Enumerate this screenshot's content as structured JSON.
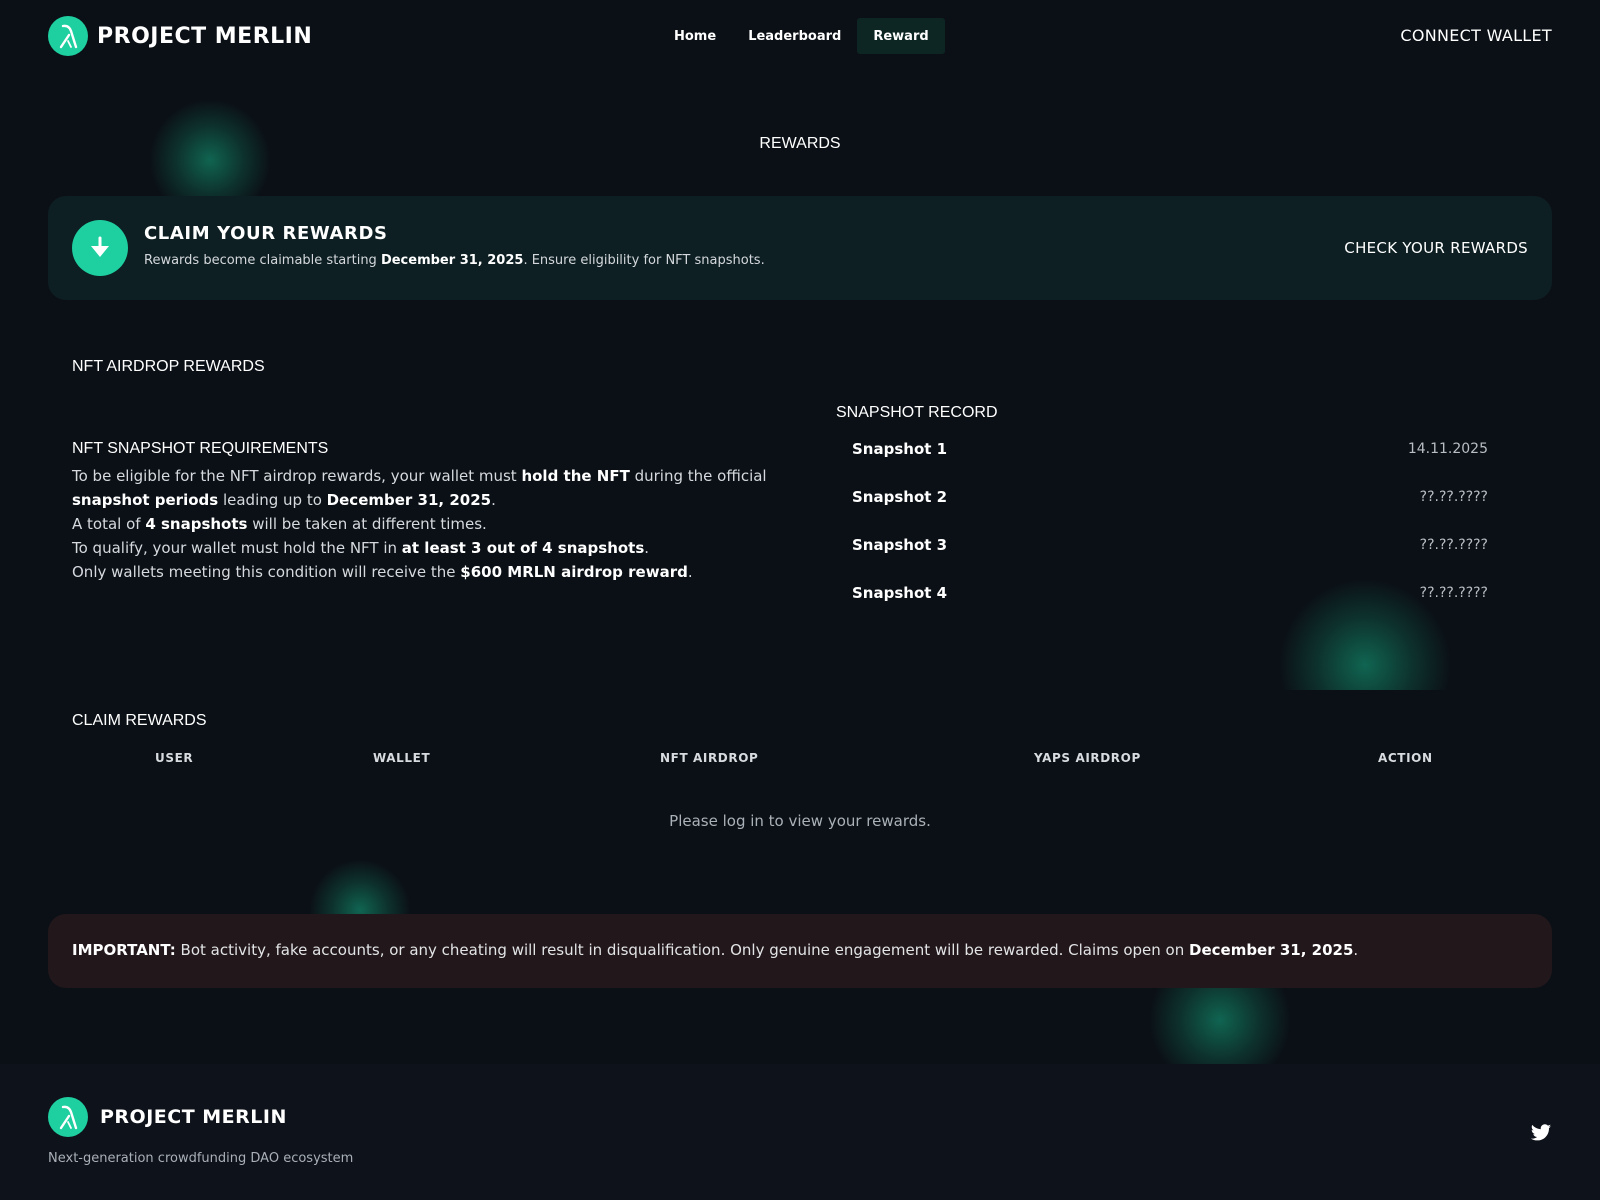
{
  "brand": {
    "name": "PROJECT MERLIN"
  },
  "nav": {
    "items": [
      {
        "label": "Home"
      },
      {
        "label": "Leaderboard"
      },
      {
        "label": "Reward"
      }
    ],
    "connect_label": "CONNECT WALLET"
  },
  "page": {
    "title": "REWARDS"
  },
  "claim_banner": {
    "title": "CLAIM YOUR REWARDS",
    "sub_prefix": "Rewards become claimable starting ",
    "sub_date": "December 31, 2025",
    "sub_suffix": ". Ensure eligibility for NFT snapshots.",
    "action_label": "CHECK YOUR REWARDS"
  },
  "nft": {
    "section_title": "NFT AIRDROP REWARDS",
    "requirements_title": "NFT SNAPSHOT REQUIREMENTS",
    "line1_a": "To be eligible for the NFT airdrop rewards, your wallet must ",
    "line1_b": "hold the NFT",
    "line1_c": " during the official ",
    "line2_a": "snapshot periods",
    "line2_b": " leading up to ",
    "line2_c": "December 31, 2025",
    "line2_d": ".",
    "line3_a": "A total of ",
    "line3_b": "4 snapshots",
    "line3_c": " will be taken at different times.",
    "line4_a": "To qualify, your wallet must hold the NFT in ",
    "line4_b": "at least 3 out of 4 snapshots",
    "line4_c": ".",
    "line5_a": "Only wallets meeting this condition will receive the ",
    "line5_b": "$600 MRLN airdrop reward",
    "line5_c": "."
  },
  "snapshots": {
    "title": "SNAPSHOT RECORD",
    "items": [
      {
        "name": "Snapshot 1",
        "date": "14.11.2025"
      },
      {
        "name": "Snapshot 2",
        "date": "??.??.????"
      },
      {
        "name": "Snapshot 3",
        "date": "??.??.????"
      },
      {
        "name": "Snapshot 4",
        "date": "??.??.????"
      }
    ]
  },
  "claim_table": {
    "title": "CLAIM REWARDS",
    "columns": [
      "USER",
      "WALLET",
      "NFT AIRDROP",
      "YAPS AIRDROP",
      "ACTION"
    ],
    "empty_message": "Please log in to view your rewards."
  },
  "important": {
    "label": "IMPORTANT:",
    "text": " Bot activity, fake accounts, or any cheating will result in disqualification. Only genuine engagement will be rewarded. Claims open on ",
    "date": "December 31, 2025",
    "end": "."
  },
  "footer": {
    "brand": "PROJECT MERLIN",
    "tagline": "Next-generation crowdfunding DAO ecosystem",
    "social_icon": "twitter-icon"
  },
  "colors": {
    "accent": "#1ecfa0",
    "background": "#0b1016",
    "banner": "#0d1f23",
    "warning_bg": "#22171b"
  }
}
